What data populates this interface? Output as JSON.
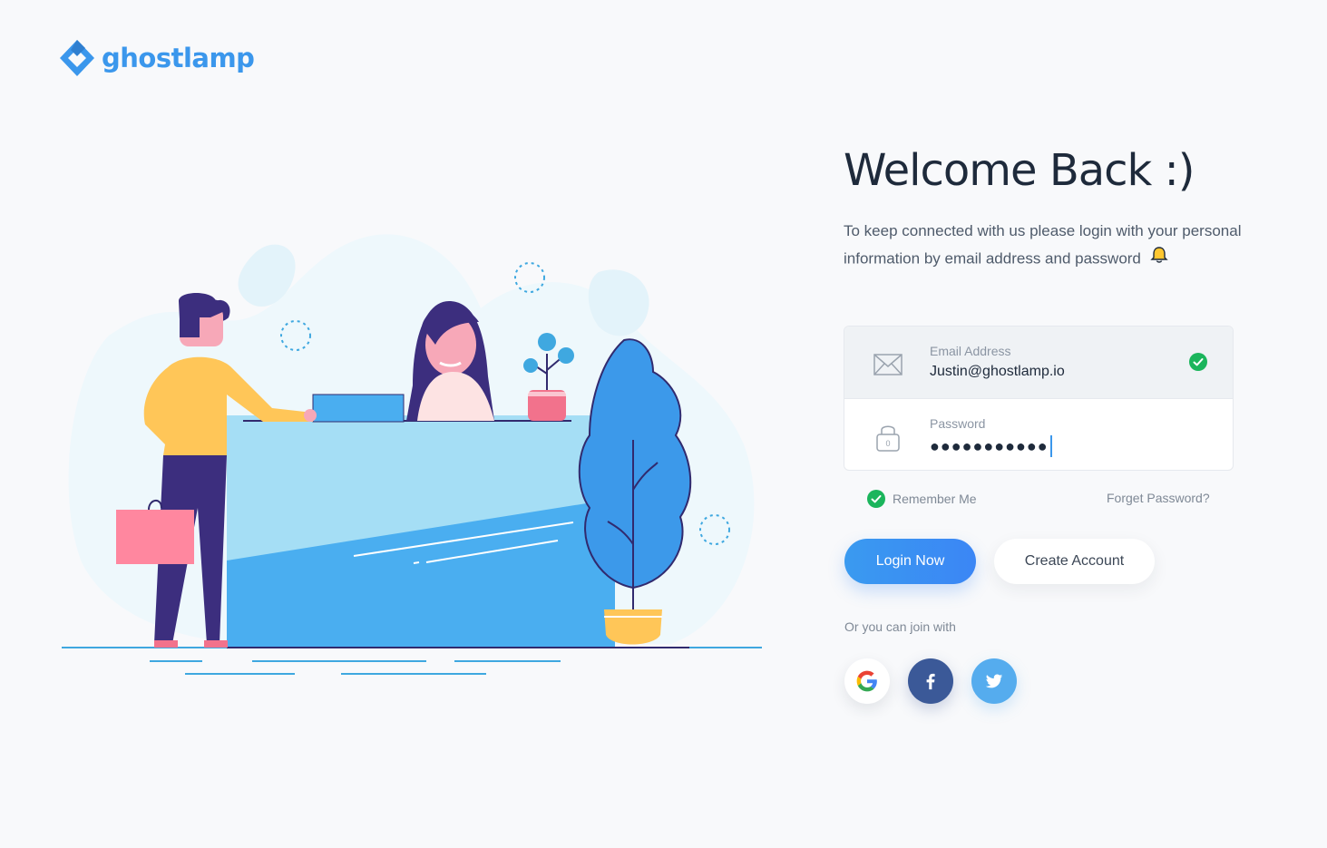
{
  "brand": {
    "name": "ghostlamp",
    "color": "#3b97ec"
  },
  "heading": {
    "title": "Welcome Back :)",
    "subtitle": "To keep connected with us please login with your personal information by email address and password"
  },
  "form": {
    "email": {
      "label": "Email Address",
      "value": "Justin@ghostlamp.io",
      "icon": "envelope-icon",
      "status": "valid"
    },
    "password": {
      "label": "Password",
      "masked_value": "●●●●●●●●●●●",
      "icon": "lock-icon"
    },
    "remember_me": {
      "label": "Remember Me",
      "checked": true
    },
    "forgot_password": "Forget Password?"
  },
  "actions": {
    "login": "Login Now",
    "create_account": "Create Account"
  },
  "social": {
    "prompt": "Or you can join with",
    "providers": [
      "Google",
      "Facebook",
      "Twitter"
    ]
  },
  "colors": {
    "accent": "#3b97ec",
    "success": "#1bb55c",
    "facebook": "#3b5998",
    "twitter": "#55acee"
  }
}
